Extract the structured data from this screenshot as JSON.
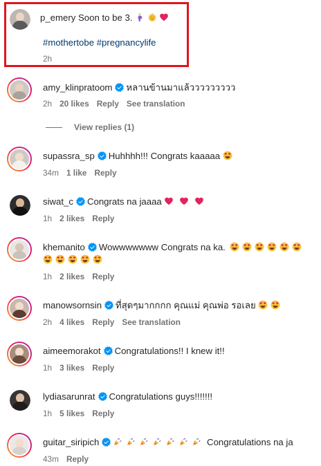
{
  "post": {
    "username": "p_emery",
    "text": "Soon to be 3.",
    "hashtags": "#mothertobe #pregnancylife",
    "time": "2h"
  },
  "view_replies": "View replies (1)",
  "comments": [
    {
      "username": "amy_klinpratoom",
      "text": "หลานข้านมาแล้ววววววววว",
      "time": "2h",
      "likes": "20 likes",
      "reply": "Reply",
      "translate": "See translation"
    },
    {
      "username": "supassra_sp",
      "text": "Huhhhh!!! Congrats kaaaaa",
      "time": "34m",
      "likes": "1 like",
      "reply": "Reply"
    },
    {
      "username": "siwat_c",
      "text": "Congrats na jaaaa",
      "time": "1h",
      "likes": "2 likes",
      "reply": "Reply"
    },
    {
      "username": "khemanito",
      "text": "Wowwwwwww Congrats na ka.",
      "time": "1h",
      "likes": "2 likes",
      "reply": "Reply"
    },
    {
      "username": "manowsornsin",
      "text": "ที่สุดๆมากกกก คุณแม่ คุณพ่อ รอเลย",
      "time": "2h",
      "likes": "4 likes",
      "reply": "Reply",
      "translate": "See translation"
    },
    {
      "username": "aimeemorakot",
      "text": "Congratulations!! I knew it!!",
      "time": "1h",
      "likes": "3 likes",
      "reply": "Reply"
    },
    {
      "username": "lydiasarunrat",
      "text": "Congratulations guys!!!!!!!",
      "time": "1h",
      "likes": "5 likes",
      "reply": "Reply"
    },
    {
      "username": "guitar_siripich",
      "text": "Congratulations na ja",
      "time": "43m",
      "reply": "Reply"
    }
  ],
  "colors": {
    "verified": "#0095f6",
    "hashtag": "#00376b",
    "highlight_border": "#e0141e",
    "heart": "#e0245e",
    "meta": "#737373"
  },
  "icons": [
    "verified-badge-icon",
    "heart-emoji",
    "heart-eyes-emoji",
    "party-popper-emoji",
    "pregnant-woman-emoji",
    "baby-emoji"
  ]
}
